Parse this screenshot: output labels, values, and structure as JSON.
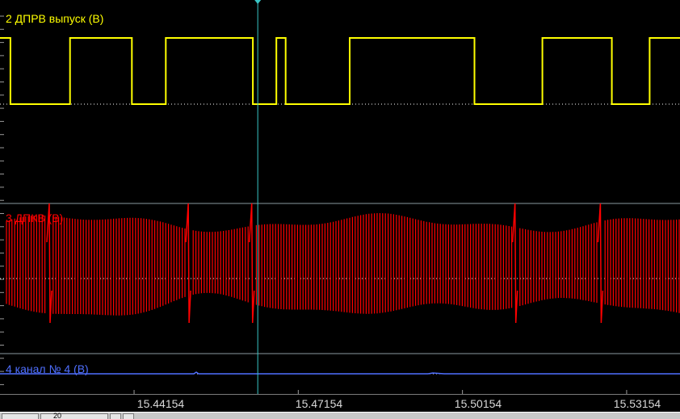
{
  "channels": [
    {
      "id": "ch2",
      "label": "2 ДПРВ выпуск (В)",
      "color": "#ffff00"
    },
    {
      "id": "ch3",
      "label": "3 ДПКВ (В)",
      "color": "#ff0000"
    },
    {
      "id": "ch4",
      "label": "4 канал № 4 (В)",
      "color": "#4f6fff"
    }
  ],
  "colors": {
    "background": "#000000",
    "cursor": "#39c6c6",
    "separator": "#8a9aa0",
    "tick": "#9a9a9a",
    "axis_text": "#d8d8d8"
  },
  "time_axis": {
    "ticks": [
      "15.44154",
      "15.47154",
      "15.50154",
      "15.53154"
    ],
    "tick_values": [
      15.44154,
      15.47154,
      15.50154,
      15.53154
    ],
    "range": [
      15.41704,
      15.54129
    ],
    "cursor_time": 15.46414
  },
  "ch2_levels": [
    {
      "t0": 15.41704,
      "t1": 15.41894,
      "state": "high"
    },
    {
      "t0": 15.41894,
      "t1": 15.42984,
      "state": "low"
    },
    {
      "t0": 15.42984,
      "t1": 15.44114,
      "state": "high"
    },
    {
      "t0": 15.44114,
      "t1": 15.44734,
      "state": "low"
    },
    {
      "t0": 15.44734,
      "t1": 15.46324,
      "state": "high"
    },
    {
      "t0": 15.46324,
      "t1": 15.46754,
      "state": "low"
    },
    {
      "t0": 15.46754,
      "t1": 15.46924,
      "state": "high"
    },
    {
      "t0": 15.46924,
      "t1": 15.48094,
      "state": "low"
    },
    {
      "t0": 15.48094,
      "t1": 15.50374,
      "state": "high"
    },
    {
      "t0": 15.50374,
      "t1": 15.51614,
      "state": "low"
    },
    {
      "t0": 15.51614,
      "t1": 15.52884,
      "state": "high"
    },
    {
      "t0": 15.52884,
      "t1": 15.53574,
      "state": "low"
    },
    {
      "t0": 15.53574,
      "t1": 15.54129,
      "state": "high"
    }
  ],
  "ch3_gaps": [
    15.42604,
    15.45144,
    15.46304,
    15.51114,
    15.52674
  ],
  "status_bar": {
    "zoom_value": "20"
  }
}
